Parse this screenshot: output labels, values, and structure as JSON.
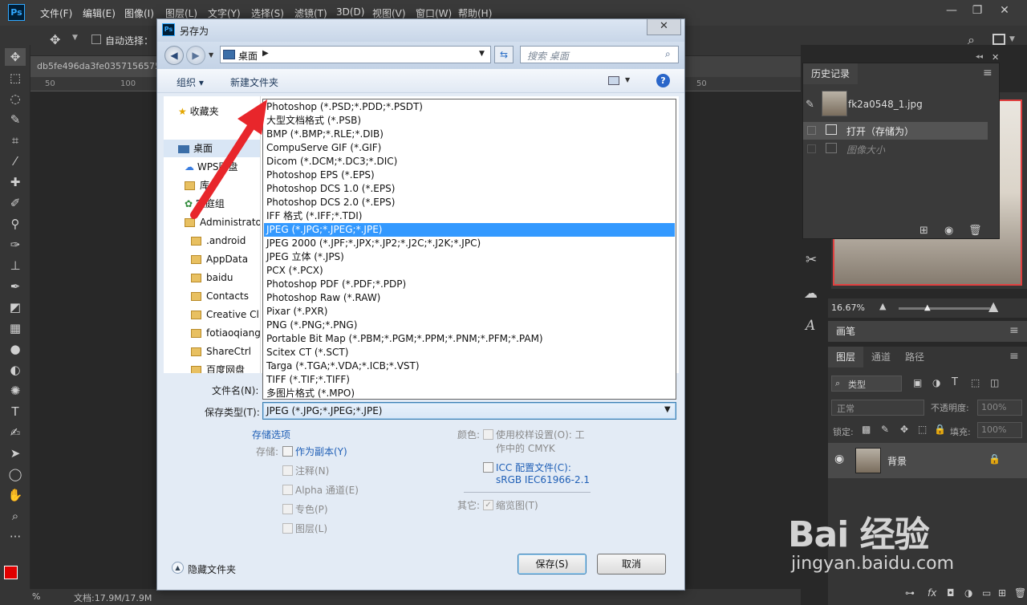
{
  "app": {
    "logo": "Ps",
    "menus": [
      "文件(F)",
      "编辑(E)",
      "图像(I)",
      "图层(L)",
      "文字(Y)",
      "选择(S)",
      "滤镜(T)",
      "3D(D)",
      "视图(V)",
      "窗口(W)",
      "帮助(H)"
    ],
    "options": {
      "auto_select": "自动选择："
    },
    "doc_tab": "db5fe496da3fe03571565752",
    "ruler_nums": [
      "50",
      "100",
      "50"
    ],
    "status": {
      "zoom": "%",
      "doc_size": "文档:17.9M/17.9M"
    }
  },
  "history_panel": {
    "tab": "历史记录",
    "snapshot": "fk2a0548_1.jpg",
    "steps": [
      "打开（存储为）",
      "图像大小"
    ]
  },
  "navigator": {
    "zoom": "16.67%"
  },
  "brush_panel": {
    "tab": "画笔"
  },
  "layers_panel": {
    "tabs": [
      "图层",
      "通道",
      "路径"
    ],
    "filter": "类型",
    "blend": "正常",
    "opacity_label": "不透明度:",
    "opacity": "100%",
    "lock_label": "锁定:",
    "fill_label": "填充:",
    "fill": "100%",
    "layer_name": "背景"
  },
  "dialog": {
    "title": "另存为",
    "address": "桌面",
    "search_placeholder": "搜索 桌面",
    "organize": "组织",
    "new_folder": "新建文件夹",
    "nav": {
      "favorites": "收藏夹",
      "desktop": "桌面",
      "items": [
        "WPS网盘",
        "库",
        "家庭组",
        "Administrato",
        ".android",
        "AppData",
        "baidu",
        "Contacts",
        "Creative Cl",
        "fotiaoqiang",
        "ShareCtrl",
        "百度网盘"
      ]
    },
    "filename_label": "文件名(N):",
    "type_label": "保存类型(T):",
    "type_value": "JPEG (*.JPG;*.JPEG;*.JPE)",
    "formats": [
      "Photoshop (*.PSD;*.PDD;*.PSDT)",
      "大型文档格式 (*.PSB)",
      "BMP (*.BMP;*.RLE;*.DIB)",
      "CompuServe GIF (*.GIF)",
      "Dicom (*.DCM;*.DC3;*.DIC)",
      "Photoshop EPS (*.EPS)",
      "Photoshop DCS 1.0 (*.EPS)",
      "Photoshop DCS 2.0 (*.EPS)",
      "IFF 格式 (*.IFF;*.TDI)",
      "JPEG (*.JPG;*.JPEG;*.JPE)",
      "JPEG 2000 (*.JPF;*.JPX;*.JP2;*.J2C;*.J2K;*.JPC)",
      "JPEG 立体 (*.JPS)",
      "PCX (*.PCX)",
      "Photoshop PDF (*.PDF;*.PDP)",
      "Photoshop Raw (*.RAW)",
      "Pixar (*.PXR)",
      "PNG (*.PNG;*.PNG)",
      "Portable Bit Map (*.PBM;*.PGM;*.PPM;*.PNM;*.PFM;*.PAM)",
      "Scitex CT (*.SCT)",
      "Targa (*.TGA;*.VDA;*.ICB;*.VST)",
      "TIFF (*.TIF;*.TIFF)",
      "多图片格式 (*.MPO)"
    ],
    "selected_format_index": 9,
    "options": {
      "save_options": "存储选项",
      "store_label": "存储:",
      "as_copy": "作为副本(Y)",
      "notes": "注释(N)",
      "alpha": "Alpha 通道(E)",
      "spot": "专色(P)",
      "layers": "图层(L)",
      "color_label": "颜色:",
      "proof_1": "使用校样设置(O):  工",
      "proof_2": "作中的 CMYK",
      "icc_1": "ICC 配置文件(C):",
      "icc_2": "sRGB IEC61966-2.1",
      "other_label": "其它:",
      "thumbnail": "缩览图(T)"
    },
    "hide_folders": "隐藏文件夹",
    "save": "保存(S)",
    "cancel": "取消"
  },
  "watermark": {
    "main": "Bai 经验",
    "sub": "jingyan.baidu.com"
  },
  "colors": {
    "accent_selection": "#3399ff",
    "arrow": "#e8262b",
    "ps_blue": "#31a8ff"
  }
}
